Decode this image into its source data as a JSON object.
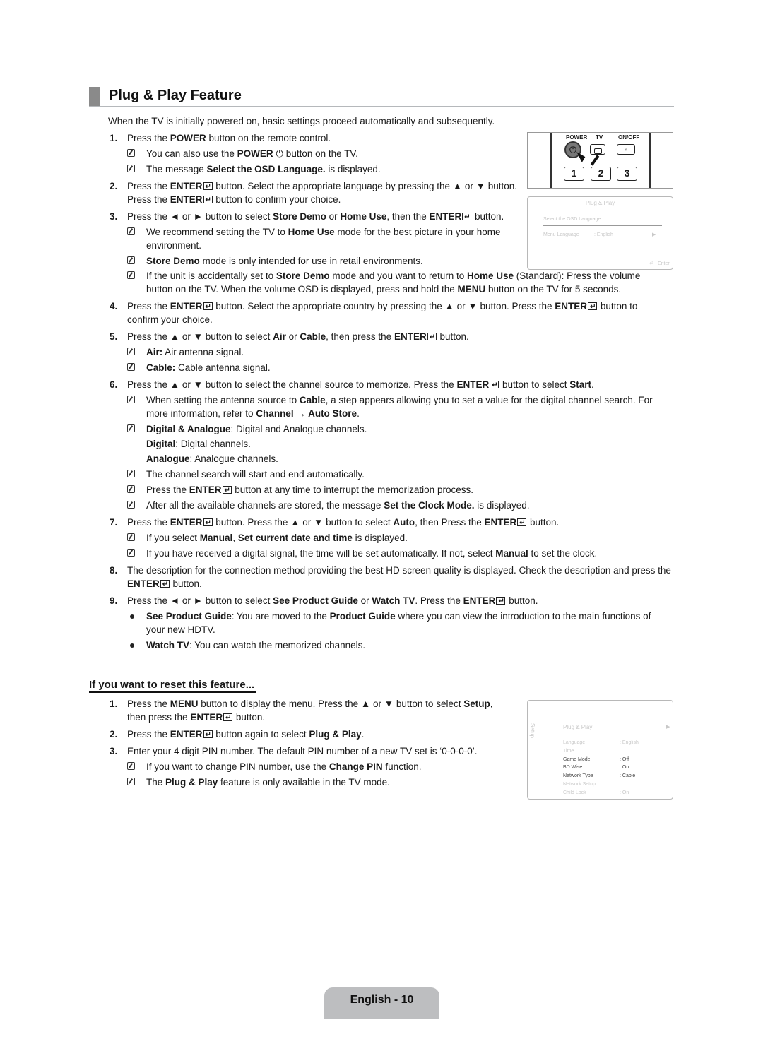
{
  "page": {
    "title": "Plug & Play Feature",
    "intro": "When the TV is initially powered on, basic settings proceed automatically and subsequently.",
    "footer": "English - 10"
  },
  "steps": [
    {
      "num": "1.",
      "parts": [
        [
          "Press the ",
          false
        ],
        [
          "POWER",
          true
        ],
        [
          " button on the remote control.",
          false
        ]
      ]
    },
    {
      "num": "2.",
      "parts": [
        [
          "Press the ",
          false
        ],
        [
          "ENTER",
          true
        ],
        [
          "{E}",
          false
        ],
        [
          " button. Select the appropriate language by pressing the ▲ or ▼ button. Press the ",
          false
        ],
        [
          "ENTER",
          true
        ],
        [
          "{E}",
          false
        ],
        [
          " button to confirm your choice.",
          false
        ]
      ]
    },
    {
      "num": "3.",
      "parts": [
        [
          "Press the ◄ or ► button to select ",
          false
        ],
        [
          "Store Demo",
          true
        ],
        [
          " or ",
          false
        ],
        [
          "Home Use",
          true
        ],
        [
          ", then the ",
          false
        ],
        [
          "ENTER",
          true
        ],
        [
          "{E}",
          false
        ],
        [
          " button.",
          false
        ]
      ]
    },
    {
      "num": "4.",
      "parts": [
        [
          "Press the ",
          false
        ],
        [
          "ENTER",
          true
        ],
        [
          "{E}",
          false
        ],
        [
          " button. Select the appropriate country by pressing the ▲ or ▼ button. Press the ",
          false
        ],
        [
          "ENTER",
          true
        ],
        [
          "{E}",
          false
        ],
        [
          " button to confirm your choice.",
          false
        ]
      ]
    },
    {
      "num": "5.",
      "parts": [
        [
          "Press the ▲ or ▼ button to select ",
          false
        ],
        [
          "Air",
          true
        ],
        [
          " or ",
          false
        ],
        [
          "Cable",
          true
        ],
        [
          ", then press the ",
          false
        ],
        [
          "ENTER",
          true
        ],
        [
          "{E}",
          false
        ],
        [
          " button.",
          false
        ]
      ]
    },
    {
      "num": "6.",
      "parts": [
        [
          "Press the ▲ or ▼ button to select the channel source to memorize. Press the ",
          false
        ],
        [
          "ENTER",
          true
        ],
        [
          "{E}",
          false
        ],
        [
          " button to select ",
          false
        ],
        [
          "Start",
          true
        ],
        [
          ".",
          false
        ]
      ]
    },
    {
      "num": "7.",
      "parts": [
        [
          "Press the ",
          false
        ],
        [
          "ENTER",
          true
        ],
        [
          "{E}",
          false
        ],
        [
          " button. Press the ▲ or ▼ button to select ",
          false
        ],
        [
          "Auto",
          true
        ],
        [
          ", then Press the ",
          false
        ],
        [
          "ENTER",
          true
        ],
        [
          "{E}",
          false
        ],
        [
          " button.",
          false
        ]
      ]
    },
    {
      "num": "8.",
      "parts": [
        [
          "The description for the connection method providing the best HD screen quality is displayed. Check the description and press the ",
          false
        ],
        [
          "ENTER",
          true
        ],
        [
          "{E}",
          false
        ],
        [
          " button.",
          false
        ]
      ]
    },
    {
      "num": "9.",
      "parts": [
        [
          "Press the ◄ or ► button to select ",
          false
        ],
        [
          "See Product Guide",
          true
        ],
        [
          " or ",
          false
        ],
        [
          "Watch TV",
          true
        ],
        [
          ". Press the ",
          false
        ],
        [
          "ENTER",
          true
        ],
        [
          "{E}",
          false
        ],
        [
          " button.",
          false
        ]
      ]
    }
  ],
  "notes": {
    "s1a": [
      [
        "You can also use the ",
        false
      ],
      [
        "POWER",
        true
      ],
      [
        " ⏻ button on the TV.",
        false
      ]
    ],
    "s1b": [
      [
        "The message ",
        false
      ],
      [
        "Select the OSD Language.",
        true
      ],
      [
        " is displayed.",
        false
      ]
    ],
    "s3a": [
      [
        "We recommend setting the TV to ",
        false
      ],
      [
        "Home Use",
        true
      ],
      [
        " mode for the best picture in your home environment.",
        false
      ]
    ],
    "s3b": [
      [
        "Store Demo",
        true
      ],
      [
        " mode is only intended for use in retail environments.",
        false
      ]
    ],
    "s3c": [
      [
        "If the unit is accidentally set to ",
        false
      ],
      [
        "Store Demo",
        true
      ],
      [
        " mode and you want to return to ",
        false
      ],
      [
        "Home Use",
        true
      ],
      [
        " (Standard): Press the volume button on the TV. When the volume OSD is displayed, press and hold the ",
        false
      ],
      [
        "MENU",
        true
      ],
      [
        " button on the TV for 5 seconds.",
        false
      ]
    ],
    "s5a": [
      [
        "Air:",
        true
      ],
      [
        " Air antenna signal.",
        false
      ]
    ],
    "s5b": [
      [
        "Cable:",
        true
      ],
      [
        " Cable antenna signal.",
        false
      ]
    ],
    "s6a": [
      [
        "When setting the antenna source to ",
        false
      ],
      [
        "Cable",
        true
      ],
      [
        ", a step appears allowing you to set a value for the digital channel search. For more information, refer to ",
        false
      ],
      [
        "Channel → Auto Store",
        true
      ],
      [
        ".",
        false
      ]
    ],
    "s6b": [
      [
        "Digital & Analogue",
        true
      ],
      [
        ": Digital and Analogue channels.",
        false
      ]
    ],
    "s6b2": [
      [
        "Digital",
        true
      ],
      [
        ": Digital channels.",
        false
      ]
    ],
    "s6b3": [
      [
        "Analogue",
        true
      ],
      [
        ": Analogue channels.",
        false
      ]
    ],
    "s6c": [
      [
        "The channel search will start and end automatically.",
        false
      ]
    ],
    "s6d": [
      [
        "Press the ",
        false
      ],
      [
        "ENTER",
        true
      ],
      [
        "{E}",
        false
      ],
      [
        " button at any time to interrupt the memorization process.",
        false
      ]
    ],
    "s6e": [
      [
        "After all the available channels are stored, the message ",
        false
      ],
      [
        "Set the Clock Mode.",
        true
      ],
      [
        " is displayed.",
        false
      ]
    ],
    "s7a": [
      [
        "If you select ",
        false
      ],
      [
        "Manual",
        true
      ],
      [
        ", ",
        false
      ],
      [
        "Set current date and time",
        true
      ],
      [
        " is displayed.",
        false
      ]
    ],
    "s7b": [
      [
        "If you have received a digital signal, the time will be set automatically. If not, select ",
        false
      ],
      [
        "Manual",
        true
      ],
      [
        " to set the clock.",
        false
      ]
    ],
    "s9a": [
      [
        "See Product Guide",
        true
      ],
      [
        ": You are moved to the ",
        false
      ],
      [
        "Product Guide",
        true
      ],
      [
        " where you can view the introduction to the main functions of your new HDTV.",
        false
      ]
    ],
    "s9b": [
      [
        "Watch TV",
        true
      ],
      [
        ": You can watch the memorized channels.",
        false
      ]
    ]
  },
  "reset": {
    "title": "If you want to reset this feature...",
    "steps": [
      {
        "num": "1.",
        "parts": [
          [
            "Press the ",
            false
          ],
          [
            "MENU",
            true
          ],
          [
            " button to display the menu. Press the ▲ or ▼ button to select ",
            false
          ],
          [
            "Setup",
            true
          ],
          [
            ", then press the ",
            false
          ],
          [
            "ENTER",
            true
          ],
          [
            "{E}",
            false
          ],
          [
            " button.",
            false
          ]
        ]
      },
      {
        "num": "2.",
        "parts": [
          [
            "Press the ",
            false
          ],
          [
            "ENTER",
            true
          ],
          [
            "{E}",
            false
          ],
          [
            " button again to select ",
            false
          ],
          [
            "Plug & Play",
            true
          ],
          [
            ".",
            false
          ]
        ]
      },
      {
        "num": "3.",
        "parts": [
          [
            "Enter your 4 digit PIN number. The default PIN number of a new TV set is ‘0-0-0-0’.",
            false
          ]
        ]
      }
    ],
    "notes": [
      [
        [
          "If you want to change PIN number, use the ",
          false
        ],
        [
          "Change PIN",
          true
        ],
        [
          " function.",
          false
        ]
      ],
      [
        [
          "The ",
          false
        ],
        [
          "Plug & Play",
          true
        ],
        [
          " feature is only available in the TV mode.",
          false
        ]
      ]
    ]
  },
  "remote": {
    "power_label": "POWER",
    "tv_label": "TV",
    "onoff_label": "ON/OFF",
    "keys": [
      "1",
      "2",
      "3"
    ]
  },
  "osd_language": {
    "title": "Plug & Play",
    "prompt": "Select the OSD Language.",
    "row_label": "Menu Language",
    "row_value": ": English",
    "enter_hint": "Enter"
  },
  "osd_setup": {
    "side_label": "Setup",
    "selected": "Plug & Play",
    "items": [
      {
        "label": "Language",
        "value": ": English",
        "active": false
      },
      {
        "label": "Time",
        "value": "",
        "active": false
      },
      {
        "label": "Game Mode",
        "value": ": Off",
        "active": true
      },
      {
        "label": "BD Wise",
        "value": ": On",
        "active": true
      },
      {
        "label": "Network Type",
        "value": ": Cable",
        "active": true
      },
      {
        "label": "Network Setup",
        "value": "",
        "active": false
      },
      {
        "label": "Child Lock",
        "value": ": On",
        "active": false
      }
    ]
  }
}
